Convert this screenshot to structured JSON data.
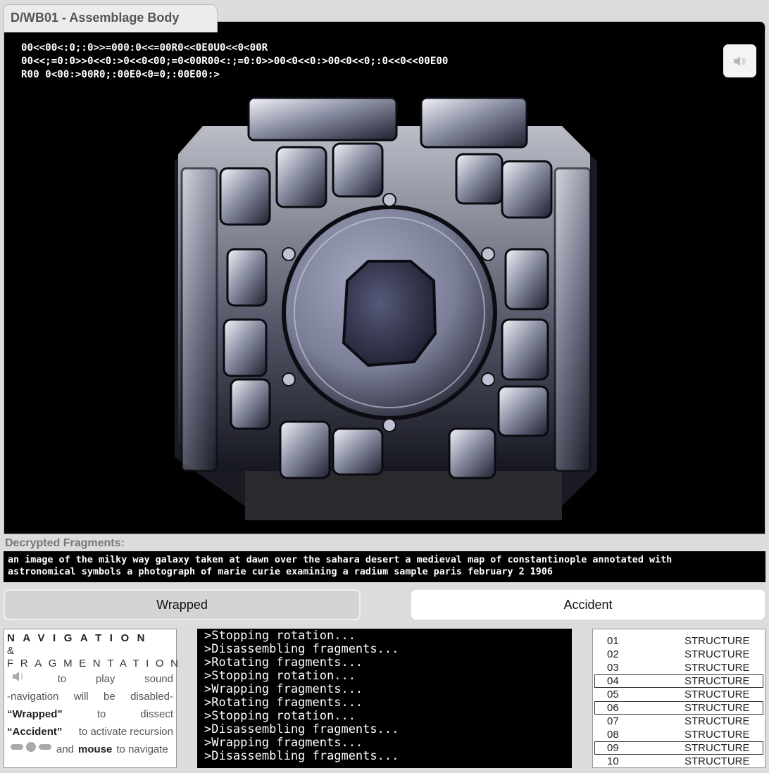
{
  "window": {
    "tab_title": "D/WB01 - Assemblage Body"
  },
  "viewport": {
    "cipher_lines": [
      "00<<00<:0;:0>>=000:0<<=00R0<<0E0U0<<0<00R",
      "00<<;=0:0>>0<<0:>0<<0<00;=0<00R00<:;=0:0>>00<0<<0:>00<0<<0;:0<<0<<00E00",
      "R00 0<00:>00R0;:00E0<0=0;:00E00:>"
    ],
    "sound_icon": "speaker-icon"
  },
  "fragments": {
    "title": "Decrypted Fragments:",
    "lines": [
      "an image of the milky way galaxy taken at dawn over the sahara desert a medieval map of constantinople annotated with",
      "astronomical symbols a photograph of marie curie examining a radium sample paris february 2 1906"
    ]
  },
  "buttons": {
    "wrapped": "Wrapped",
    "accident": "Accident"
  },
  "nav": {
    "heading1": "NAVIGATION",
    "amp": "&",
    "heading2": "FRAGMENTATION",
    "rows": [
      [
        "to",
        "play",
        "sound"
      ],
      [
        "-navigation",
        "will",
        "be",
        "disabled-"
      ],
      [
        "“Wrapped”",
        "to",
        "dissect"
      ],
      [
        "“Accident”",
        "to activate recursion"
      ],
      [
        "and",
        "mouse",
        "to navigate"
      ]
    ]
  },
  "console": {
    "lines": [
      ">Stopping rotation...",
      ">Disassembling fragments...",
      ">Rotating fragments...",
      ">Stopping rotation...",
      ">Wrapping fragments...",
      ">Rotating fragments...",
      ">Stopping rotation...",
      ">Disassembling fragments...",
      ">Wrapping fragments...",
      ">Disassembling fragments..."
    ]
  },
  "structures": [
    {
      "num": "01",
      "label": "STRUCTURE",
      "selected": false
    },
    {
      "num": "02",
      "label": "STRUCTURE",
      "selected": false
    },
    {
      "num": "03",
      "label": "STRUCTURE",
      "selected": false
    },
    {
      "num": "04",
      "label": "STRUCTURE",
      "selected": true
    },
    {
      "num": "05",
      "label": "STRUCTURE",
      "selected": false
    },
    {
      "num": "06",
      "label": "STRUCTURE",
      "selected": true
    },
    {
      "num": "07",
      "label": "STRUCTURE",
      "selected": false
    },
    {
      "num": "08",
      "label": "STRUCTURE",
      "selected": false
    },
    {
      "num": "09",
      "label": "STRUCTURE",
      "selected": true
    },
    {
      "num": "10",
      "label": "STRUCTURE",
      "selected": false
    }
  ]
}
